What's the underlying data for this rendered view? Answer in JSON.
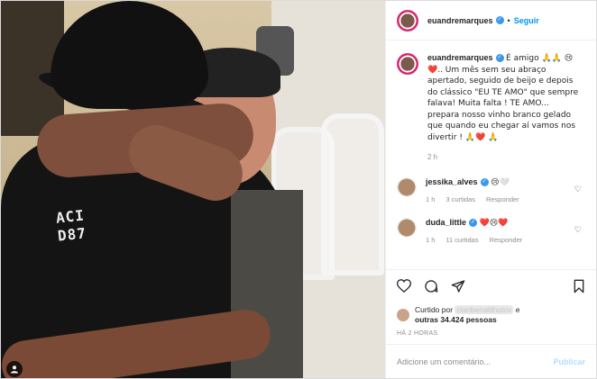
{
  "post": {
    "username": "euandremarques",
    "follow_label": "Seguir",
    "dot": "•",
    "shirt_text_line1": "ACI",
    "shirt_text_line2": "D87",
    "user_tag_icon": "person-icon"
  },
  "caption": {
    "username": "euandremarques",
    "text": "É amigo 🙏🙏 😢❤️.. Um mês sem seu abraço apertado, seguido de beijo e depois do clássico \"EU TE AMO\" que sempre falava! Muita falta ! TE AMO... prepara nosso vinho branco gelado que quando eu chegar aí vamos nos divertir ! 🙏❤️ 🙏",
    "time": "2 h"
  },
  "comments": [
    {
      "username": "jessika_alves",
      "text": "😢🤍",
      "time": "1 h",
      "likes": "3 curtidas",
      "reply": "Responder"
    },
    {
      "username": "duda_little",
      "text": "❤️😢❤️",
      "time": "1 h",
      "likes": "11 curtidas",
      "reply": "Responder"
    }
  ],
  "likes": {
    "prefix": "Curtido por",
    "blurred_user": "claribenalilhutov",
    "connector": "e",
    "others": "outras 34.424 pessoas"
  },
  "ago": "HÁ 2 HORAS",
  "add_comment": {
    "placeholder": "Adicione um comentário...",
    "publish": "Publicar"
  }
}
